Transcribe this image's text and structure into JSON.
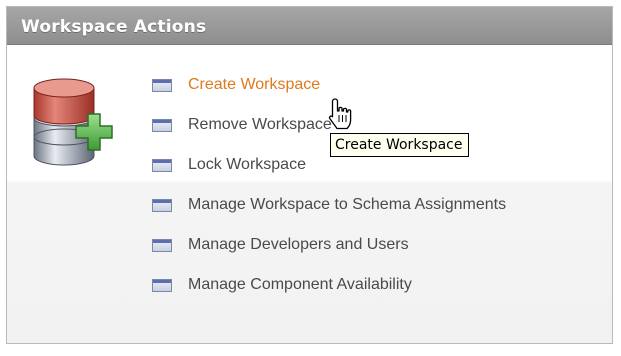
{
  "panel": {
    "title": "Workspace Actions"
  },
  "actions": [
    {
      "label": "Create Workspace"
    },
    {
      "label": "Remove Workspace"
    },
    {
      "label": "Lock Workspace"
    },
    {
      "label": "Manage Workspace to Schema Assignments"
    },
    {
      "label": "Manage Developers and Users"
    },
    {
      "label": "Manage Component Availability"
    }
  ],
  "tooltip": {
    "text": "Create Workspace"
  },
  "icons": {
    "panel_icon": "database-add-icon",
    "action_icon": "window-icon",
    "cursor": "hand-pointer-icon"
  },
  "colors": {
    "header": "#999999",
    "link_active": "#e07a1e",
    "link_default": "#4a4a4a"
  }
}
